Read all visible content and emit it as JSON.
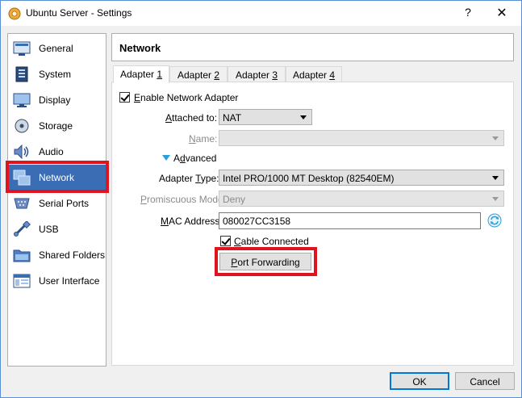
{
  "window": {
    "title": "Ubuntu Server - Settings",
    "help_glyph": "?",
    "close_glyph": "✕"
  },
  "sidebar": {
    "items": [
      {
        "label": "General",
        "icon": "general-icon"
      },
      {
        "label": "System",
        "icon": "system-icon"
      },
      {
        "label": "Display",
        "icon": "display-icon"
      },
      {
        "label": "Storage",
        "icon": "storage-icon"
      },
      {
        "label": "Audio",
        "icon": "audio-icon"
      },
      {
        "label": "Network",
        "icon": "network-icon",
        "selected": true
      },
      {
        "label": "Serial Ports",
        "icon": "serial-ports-icon"
      },
      {
        "label": "USB",
        "icon": "usb-icon"
      },
      {
        "label": "Shared Folders",
        "icon": "shared-folders-icon"
      },
      {
        "label": "User Interface",
        "icon": "user-interface-icon"
      }
    ]
  },
  "page": {
    "title": "Network"
  },
  "tabs": [
    {
      "prefix": "Adapter ",
      "accel": "1"
    },
    {
      "prefix": "Adapter ",
      "accel": "2"
    },
    {
      "prefix": "Adapter ",
      "accel": "3"
    },
    {
      "prefix": "Adapter ",
      "accel": "4"
    }
  ],
  "adapter": {
    "enable": {
      "accel": "E",
      "rest": "nable Network Adapter",
      "checked": true
    },
    "attached_to": {
      "label_accel": "A",
      "label_rest": "ttached to:",
      "value": "NAT"
    },
    "name": {
      "label_accel": "N",
      "label_rest": "ame:",
      "value": ""
    },
    "advanced": {
      "accel": "d",
      "before": "A",
      "after": "vanced"
    },
    "adapter_type": {
      "label_before": "Adapter ",
      "label_accel": "T",
      "label_rest": "ype:",
      "value": "Intel PRO/1000 MT Desktop (82540EM)"
    },
    "promiscuous": {
      "label_accel": "P",
      "label_rest": "romiscuous Mode:",
      "value": "Deny"
    },
    "mac": {
      "label_accel": "M",
      "label_rest": "AC Address:",
      "value": "080027CC3158"
    },
    "cable": {
      "accel": "C",
      "rest": "able Connected",
      "checked": true
    },
    "port_forwarding": {
      "accel": "P",
      "rest": "ort Forwarding"
    }
  },
  "footer": {
    "ok_label": "OK",
    "cancel_label": "Cancel"
  },
  "colors": {
    "selection": "#3b6db5",
    "highlight_red": "#e1141e",
    "accent_blue": "#0078d7"
  }
}
